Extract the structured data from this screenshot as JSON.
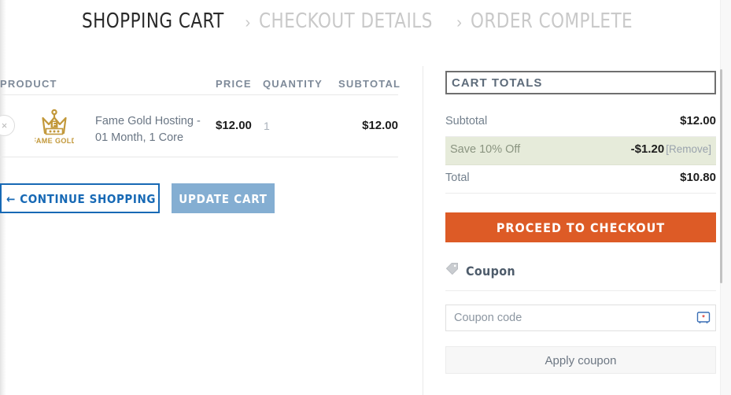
{
  "breadcrumb": {
    "steps": [
      {
        "label": "SHOPPING CART",
        "state": "active"
      },
      {
        "label": "CHECKOUT DETAILS",
        "state": "muted"
      },
      {
        "label": "ORDER COMPLETE",
        "state": "muted"
      }
    ],
    "separator": "›"
  },
  "cart_table": {
    "headers": {
      "product": "PRODUCT",
      "price": "PRICE",
      "quantity": "QUANTITY",
      "subtotal": "SUBTOTAL"
    },
    "rows": [
      {
        "remove_label": "×",
        "thumb_icon": "fame-gold-crown-logo",
        "thumb_text": "FAME GOLD",
        "thumb_badge": "F",
        "name": "Fame Gold Hosting - 01 Month, 1 Core",
        "price": "$12.00",
        "quantity": "1",
        "subtotal": "$12.00"
      }
    ]
  },
  "actions": {
    "continue_shopping": "← CONTINUE SHOPPING",
    "update_cart": "UPDATE CART"
  },
  "totals": {
    "heading": "CART TOTALS",
    "rows": [
      {
        "label": "Subtotal",
        "value": "$12.00",
        "type": "subtotal"
      },
      {
        "label": "Save 10% Off",
        "value": "-$1.20",
        "remove": "[Remove]",
        "type": "discount"
      },
      {
        "label": "Total",
        "value": "$10.80",
        "type": "total"
      }
    ],
    "checkout_button": "PROCEED TO CHECKOUT"
  },
  "coupon": {
    "heading": "Coupon",
    "tag_icon": "tag-icon",
    "input_value": "",
    "placeholder": "Coupon code",
    "password_manager_icon": "password-manager-icon",
    "apply_button": "Apply coupon"
  },
  "colors": {
    "accent_orange": "#dd5b26",
    "link_blue": "#1769b5",
    "update_blue": "#84aed2",
    "discount_green_bg": "#e6ebda",
    "logo_gold": "#c2983a",
    "header_gray": "#7e8a99"
  }
}
